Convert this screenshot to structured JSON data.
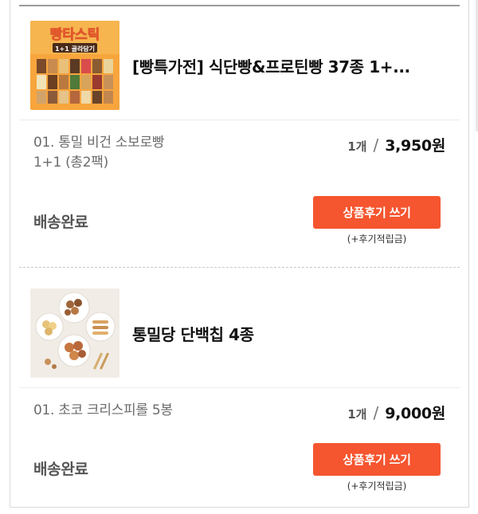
{
  "orders": [
    {
      "title": "[빵특가전] 식단빵&프로틴빵 37종 1+...",
      "thumb": {
        "icon": "bread-variety-pack-image",
        "brand_text": "빵타스틱",
        "promo_text": "1+1 골라담기"
      },
      "option": [
        "01. 통밀 비건 소보로빵",
        "1+1 (총2팩)"
      ],
      "qty": "1개",
      "price": "3,950원",
      "status": "배송완료",
      "review_button": "상품후기 쓰기",
      "review_note": "(+후기적립금)"
    },
    {
      "title": "통밀당 단백칩 4종",
      "thumb": {
        "icon": "protein-chips-plates-image"
      },
      "option": [
        "01. 초코 크리스피롤 5봉"
      ],
      "qty": "1개",
      "price": "9,000원",
      "status": "배송완료",
      "review_button": "상품후기 쓰기",
      "review_note": "(+후기적립금)"
    }
  ],
  "colors": {
    "accent": "#f5552f",
    "divider": "#ececec"
  }
}
